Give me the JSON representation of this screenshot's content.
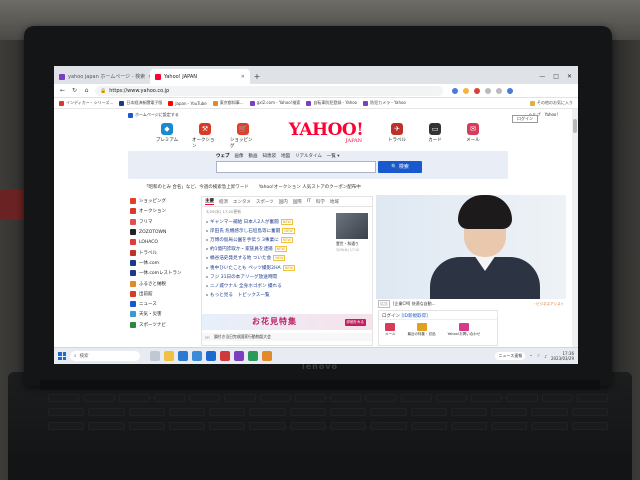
{
  "tabs": [
    {
      "label": "yahoo japan ホームページ - 検索",
      "active": false
    },
    {
      "label": "Yahoo! JAPAN",
      "active": true
    }
  ],
  "window_controls": {
    "minimize": "—",
    "maximize": "□",
    "close": "✕"
  },
  "address_bar": {
    "url": "https://www.yahoo.co.jp"
  },
  "bookmarks": {
    "items": [
      "インディカー・シリーズ...",
      "日本経済新聞電子版",
      "Japan - YouTube",
      "東京都知事...",
      "gxl2.com - Yahoo!検索",
      "自転車防犯登録 - Yahoo",
      "防犯カメラ - Yahoo"
    ],
    "right": "その他のお気に入り"
  },
  "page": {
    "utility": {
      "home_label": "ホームページに設定する",
      "links": [
        "ヘルプ",
        "Yahoo!"
      ],
      "login_badge": "ログイン"
    },
    "logo": {
      "main": "YAHOO!",
      "sub": "JAPAN"
    },
    "services_left": [
      {
        "label": "プレミアム",
        "icon": "premium-icon",
        "color": "#1a8ad0"
      },
      {
        "label": "オークション",
        "icon": "auction-hammer-icon",
        "color": "#d83a2a"
      },
      {
        "label": "ショッピング",
        "icon": "shopping-cart-icon",
        "color": "#e0402a"
      }
    ],
    "services_right": [
      {
        "label": "トラベル",
        "icon": "suitcase-icon",
        "color": "#c0302a"
      },
      {
        "label": "カード",
        "icon": "card-icon",
        "color": "#333333"
      },
      {
        "label": "メール",
        "icon": "mail-icon",
        "color": "#d83a5a"
      }
    ],
    "search": {
      "tabs": [
        "ウェブ",
        "画像",
        "動画",
        "知恵袋",
        "地図",
        "リアルタイム",
        "一覧 ▾"
      ],
      "selected_tab": "ウェブ",
      "placeholder": "",
      "button": "検索"
    },
    "promo": {
      "left": "「昭和のとみ 合名」など、今週の検索急上昇ワード",
      "right": "Yahoo!オークション 人気ストアのクーポン配布中"
    },
    "left_nav": [
      {
        "label": "ショッピング",
        "color": "#e0402a"
      },
      {
        "label": "オークション",
        "color": "#d83a2a"
      },
      {
        "label": "フリマ",
        "color": "#e05050"
      },
      {
        "label": "ZOZOTOWN",
        "color": "#222222"
      },
      {
        "label": "LOHACO",
        "color": "#e03a3a"
      },
      {
        "label": "トラベル",
        "color": "#c0302a"
      },
      {
        "label": "一休.com",
        "color": "#1a3a8a"
      },
      {
        "label": "一休.comレストラン",
        "color": "#1a3a8a"
      },
      {
        "label": "ふるさと納税",
        "color": "#e08a2a"
      },
      {
        "label": "出前館",
        "color": "#d83a2a"
      },
      {
        "label": "ニュース",
        "color": "#1a58d0"
      },
      {
        "label": "天気・災害",
        "color": "#3a9ad0"
      },
      {
        "label": "スポーツナビ",
        "color": "#2a8a3a"
      }
    ],
    "news": {
      "tabs": [
        "主要",
        "経済",
        "エンタメ",
        "スポーツ",
        "国内",
        "国際",
        "IT",
        "科学",
        "地域"
      ],
      "selected_tab": "主要",
      "date": "3/29(水) 17:20更新",
      "items": [
        {
          "text": "ギャンマー補給 日本人2人が奮闘",
          "tag": "NEW"
        },
        {
          "text": "岸田氏 危機感示し石垣島等に奮闘",
          "tag": "NEW"
        },
        {
          "text": "万博の仮局公園を手伝う 3事業に",
          "tag": "NEW"
        },
        {
          "text": "約1億円詐取か・家族員を逮捕",
          "tag": "NEW"
        },
        {
          "text": "桶谷浩史発見する地 ついた会",
          "tag": "NEW"
        },
        {
          "text": "喪中ひいたことも ペッツ撮影2HA",
          "tag": "NEW"
        },
        {
          "text": "フジ 31日の本アリーグ放送時間",
          "tag": ""
        },
        {
          "text": "ニノ城ウナル 全身ホゴボン 撮れる",
          "tag": ""
        },
        {
          "text": "もっと見る　トピックス一覧",
          "tag": ""
        }
      ],
      "thumb_caption": "壹世・和通り",
      "thumb_meta": "3/29(水) 17:10"
    },
    "banner": {
      "text": "お花見特集",
      "cta": "詳細をみる"
    },
    "pr_strip": {
      "pr": "PR",
      "text": "鎖付き当日完成国家行動物語大会"
    },
    "hero": {
      "caption_pr": "広告",
      "caption": "[企業CM] 快適な自動...",
      "note": "・ビジネスアシスト"
    },
    "login_box": {
      "header": "ログイン",
      "header_link": "[ID新規取得]",
      "links": [
        "メール",
        "最近の特集・賞品",
        "Yahoo!お問い合わせ"
      ]
    }
  },
  "taskbar": {
    "search_placeholder": "検索",
    "weather": "ニュース速報",
    "time": "17:36",
    "date": "2023/03/29"
  },
  "laptop": {
    "brand": "lenovo"
  }
}
